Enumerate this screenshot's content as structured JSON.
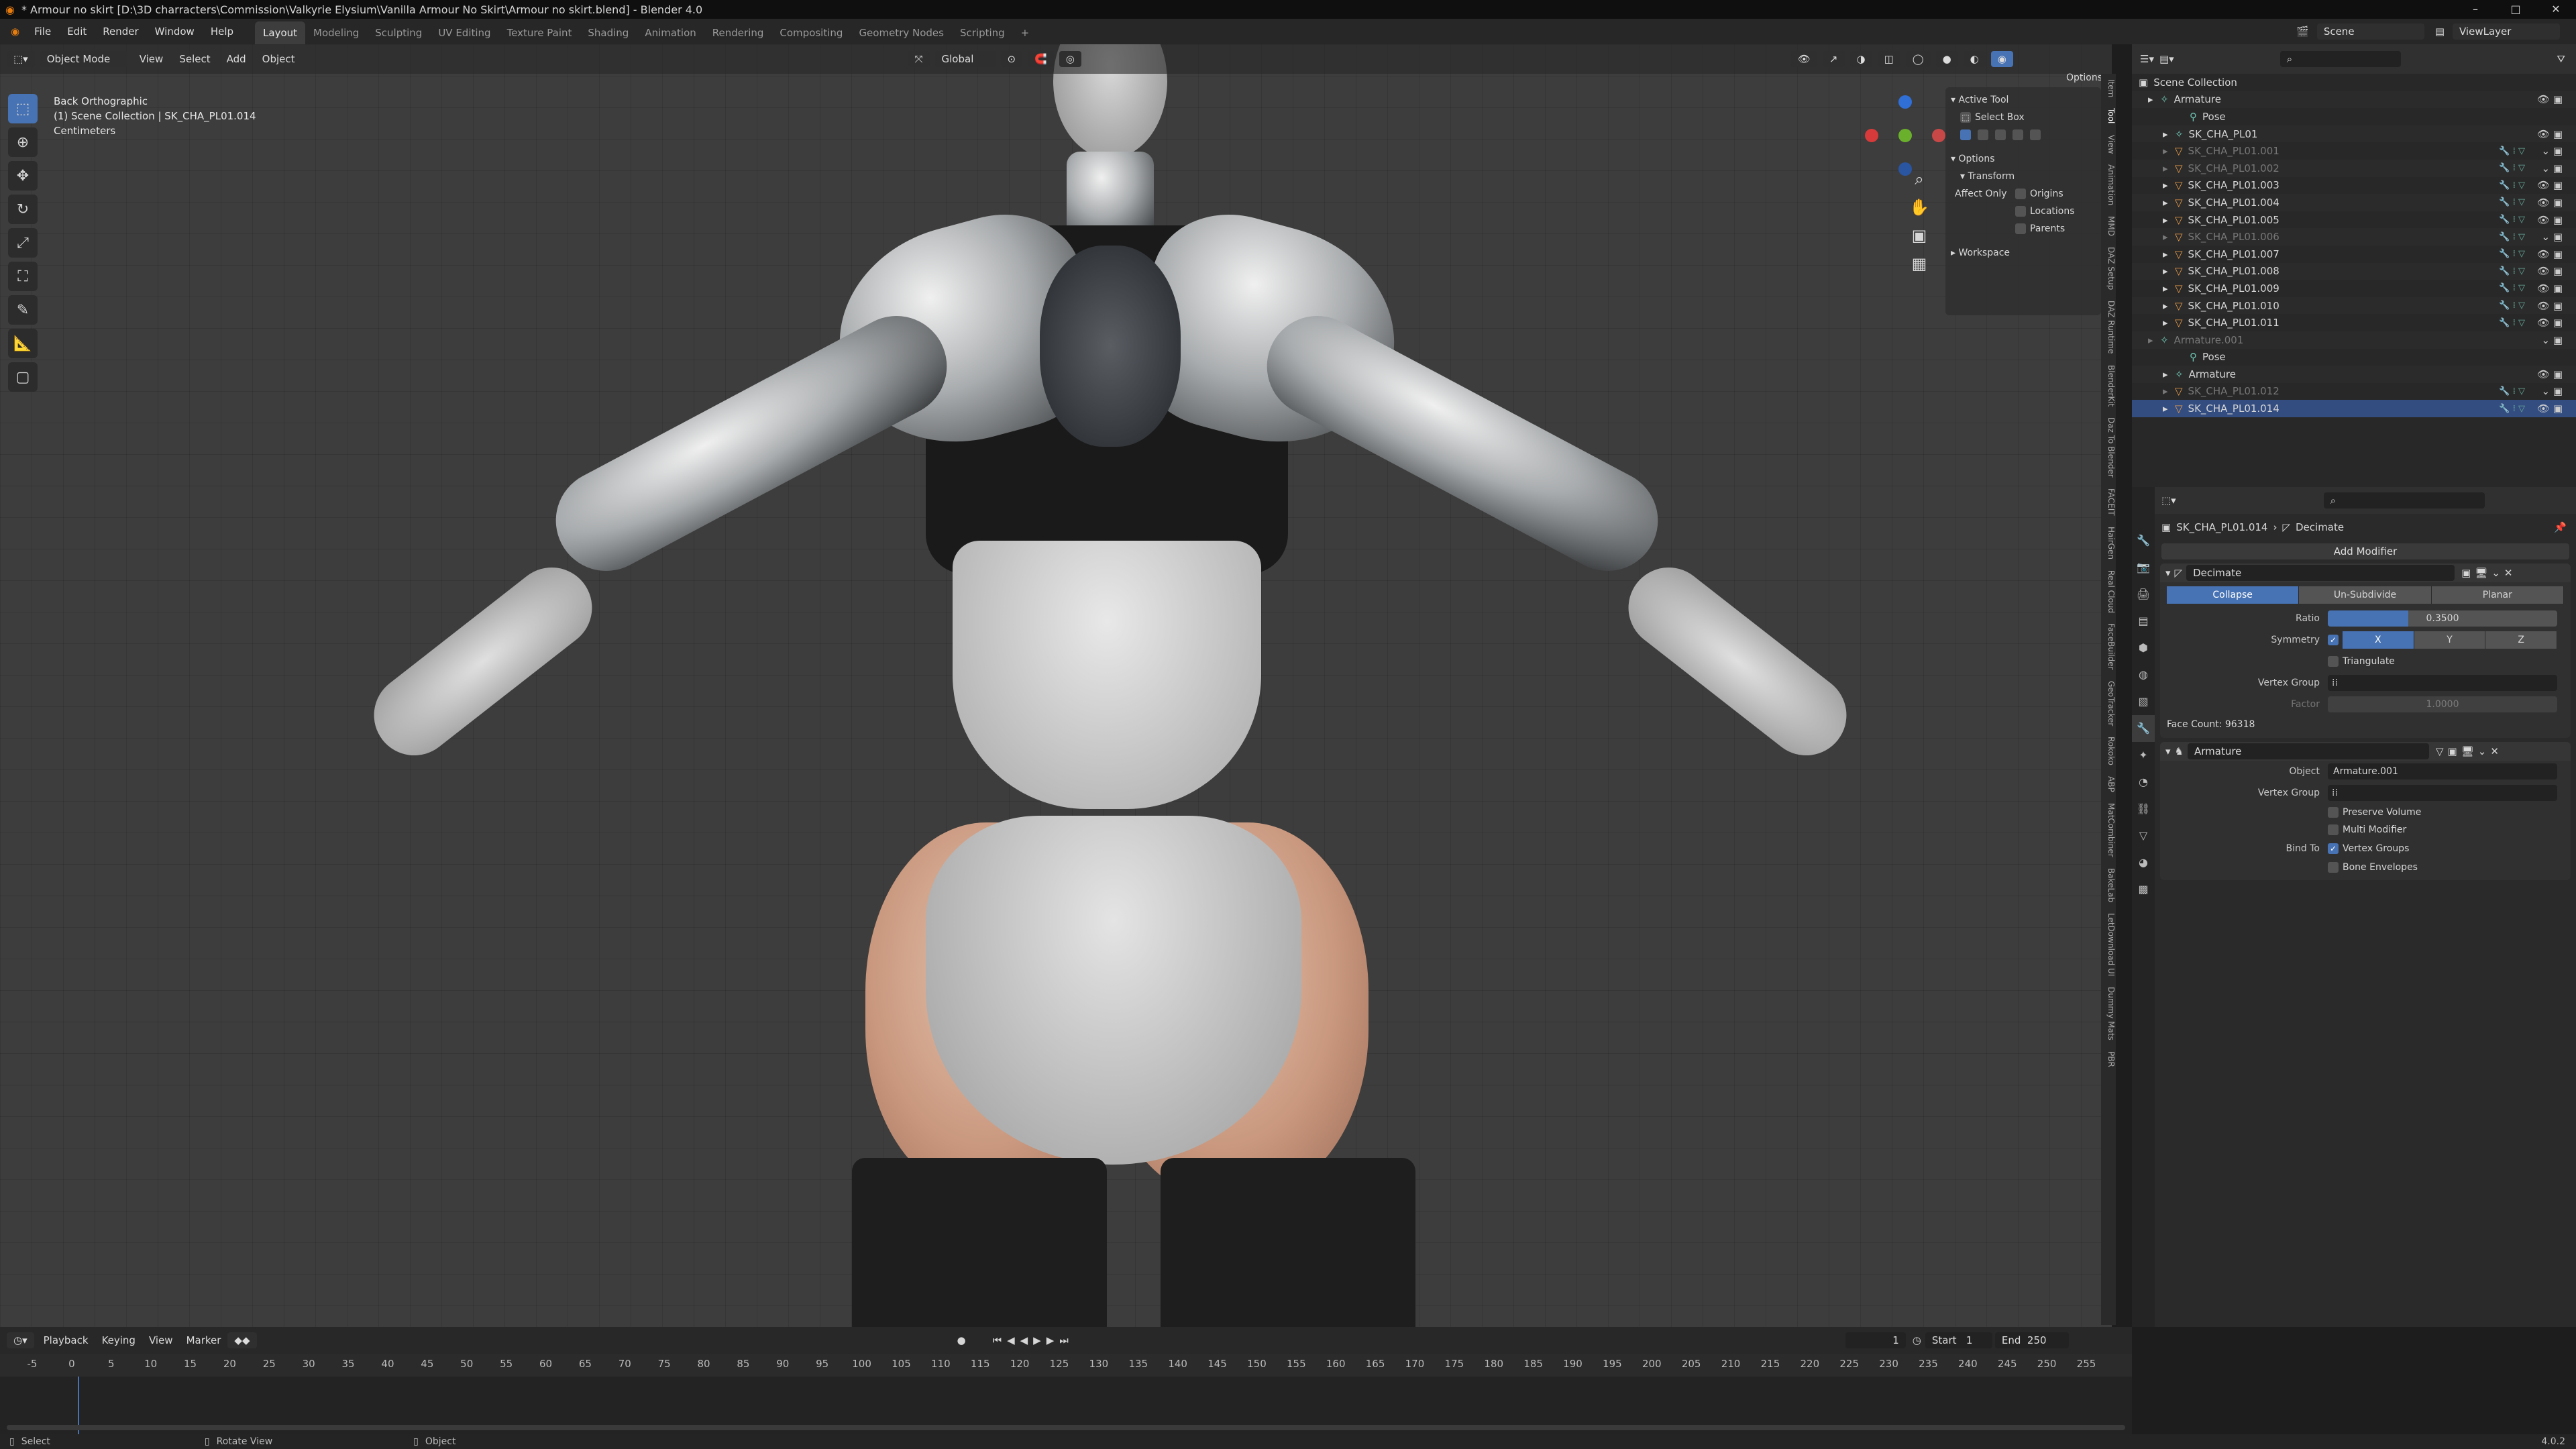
{
  "window": {
    "title": "* Armour no skirt [D:\\3D charracters\\Commission\\Valkyrie Elysium\\Vanilla Armour No Skirt\\Armour no skirt.blend] - Blender 4.0",
    "controls": [
      "–",
      "□",
      "✕"
    ]
  },
  "menus": [
    "File",
    "Edit",
    "Render",
    "Window",
    "Help"
  ],
  "workspaces": [
    "Layout",
    "Modeling",
    "Sculpting",
    "UV Editing",
    "Texture Paint",
    "Shading",
    "Animation",
    "Rendering",
    "Compositing",
    "Geometry Nodes",
    "Scripting",
    "+"
  ],
  "active_workspace": "Layout",
  "scene": {
    "label": "Scene",
    "viewlayer": "ViewLayer"
  },
  "viewport": {
    "mode": "Object Mode",
    "menus": [
      "View",
      "Select",
      "Add",
      "Object"
    ],
    "orientation": "Global",
    "options": "Options",
    "info": [
      "Back Orthographic",
      "(1) Scene Collection | SK_CHA_PL01.014",
      "Centimeters"
    ]
  },
  "npanel": {
    "active_tool_header": "Active Tool",
    "select_box": "Select Box",
    "options_header": "Options",
    "transform_header": "Transform",
    "affect_only": "Affect Only",
    "origins": "Origins",
    "locations": "Locations",
    "parents": "Parents",
    "workspace_header": "Workspace"
  },
  "side_tabs": [
    "Item",
    "Tool",
    "View",
    "Animation",
    "MMD",
    "DAZ Setup",
    "DAZ Runtime",
    "BlenderKit",
    "Daz To Blender",
    "FACEIT",
    "HairGen",
    "Real Cloud",
    "FaceBuilder",
    "GeoTracker",
    "Rokoko",
    "ABP",
    "MatCombiner",
    "BakeLab",
    "LetDownload UI",
    "Dummy Mats",
    "PBR"
  ],
  "outliner": {
    "header": "Scene Collection",
    "rows": [
      {
        "name": "Armature",
        "indent": 0,
        "icon": "armature-icon",
        "dim": false
      },
      {
        "name": "Pose",
        "indent": 2,
        "icon": "pose-icon",
        "dim": false
      },
      {
        "name": "SK_CHA_PL01",
        "indent": 1,
        "icon": "armature-data-icon",
        "dim": false
      },
      {
        "name": "SK_CHA_PL01.001",
        "indent": 1,
        "icon": "mesh-icon",
        "dim": true
      },
      {
        "name": "SK_CHA_PL01.002",
        "indent": 1,
        "icon": "mesh-icon",
        "dim": true
      },
      {
        "name": "SK_CHA_PL01.003",
        "indent": 1,
        "icon": "mesh-icon",
        "dim": false
      },
      {
        "name": "SK_CHA_PL01.004",
        "indent": 1,
        "icon": "mesh-icon",
        "dim": false
      },
      {
        "name": "SK_CHA_PL01.005",
        "indent": 1,
        "icon": "mesh-icon",
        "dim": false
      },
      {
        "name": "SK_CHA_PL01.006",
        "indent": 1,
        "icon": "mesh-icon",
        "dim": true
      },
      {
        "name": "SK_CHA_PL01.007",
        "indent": 1,
        "icon": "mesh-icon",
        "dim": false
      },
      {
        "name": "SK_CHA_PL01.008",
        "indent": 1,
        "icon": "mesh-icon",
        "dim": false
      },
      {
        "name": "SK_CHA_PL01.009",
        "indent": 1,
        "icon": "mesh-icon",
        "dim": false
      },
      {
        "name": "SK_CHA_PL01.010",
        "indent": 1,
        "icon": "mesh-icon",
        "dim": false
      },
      {
        "name": "SK_CHA_PL01.011",
        "indent": 1,
        "icon": "mesh-icon",
        "dim": false
      },
      {
        "name": "Armature.001",
        "indent": 0,
        "icon": "armature-icon",
        "dim": true
      },
      {
        "name": "Pose",
        "indent": 2,
        "icon": "pose-icon",
        "dim": false
      },
      {
        "name": "Armature",
        "indent": 1,
        "icon": "armature-data-icon",
        "dim": false
      },
      {
        "name": "SK_CHA_PL01.012",
        "indent": 1,
        "icon": "mesh-icon",
        "dim": true
      },
      {
        "name": "SK_CHA_PL01.014",
        "indent": 1,
        "icon": "mesh-icon",
        "dim": false
      }
    ]
  },
  "properties": {
    "breadcrumb_object": "SK_CHA_PL01.014",
    "breadcrumb_modifier": "Decimate",
    "add_modifier": "Add Modifier",
    "decimate": {
      "name": "Decimate",
      "modes": [
        "Collapse",
        "Un-Subdivide",
        "Planar"
      ],
      "active_mode": "Collapse",
      "ratio_label": "Ratio",
      "ratio": "0.3500",
      "ratio_fraction": 0.35,
      "symmetry_label": "Symmetry",
      "axes": [
        "X",
        "Y",
        "Z"
      ],
      "triangulate": "Triangulate",
      "vertex_group_label": "Vertex Group",
      "factor_label": "Factor",
      "factor": "1.0000",
      "face_count": "Face Count: 96318"
    },
    "armature_mod": {
      "name": "Armature",
      "object_label": "Object",
      "object_value": "Armature.001",
      "vertex_group_label": "Vertex Group",
      "preserve_volume": "Preserve Volume",
      "multi_modifier": "Multi Modifier",
      "bind_to_label": "Bind To",
      "vertex_groups": "Vertex Groups",
      "bone_envelopes": "Bone Envelopes"
    }
  },
  "timeline": {
    "menus": [
      "Playback",
      "Keying",
      "View",
      "Marker"
    ],
    "current_frame": "1",
    "start_label": "Start",
    "start": "1",
    "end_label": "End",
    "end": "250",
    "ticks": [
      "-5",
      "0",
      "5",
      "10",
      "15",
      "20",
      "25",
      "30",
      "35",
      "40",
      "45",
      "50",
      "55",
      "60",
      "65",
      "70",
      "75",
      "80",
      "85",
      "90",
      "95",
      "100",
      "105",
      "110",
      "115",
      "120",
      "125",
      "130",
      "135",
      "140",
      "145",
      "150",
      "155",
      "160",
      "165",
      "170",
      "175",
      "180",
      "185",
      "190",
      "195",
      "200",
      "205",
      "210",
      "215",
      "220",
      "225",
      "230",
      "235",
      "240",
      "245",
      "250",
      "255"
    ]
  },
  "statusbar": {
    "select": "Select",
    "rotate": "Rotate View",
    "object": "Object",
    "version": "4.0.2"
  },
  "colors": {
    "accent": "#4772b3",
    "bg": "#1d1d1d",
    "viewport": "#3d3d3d"
  }
}
